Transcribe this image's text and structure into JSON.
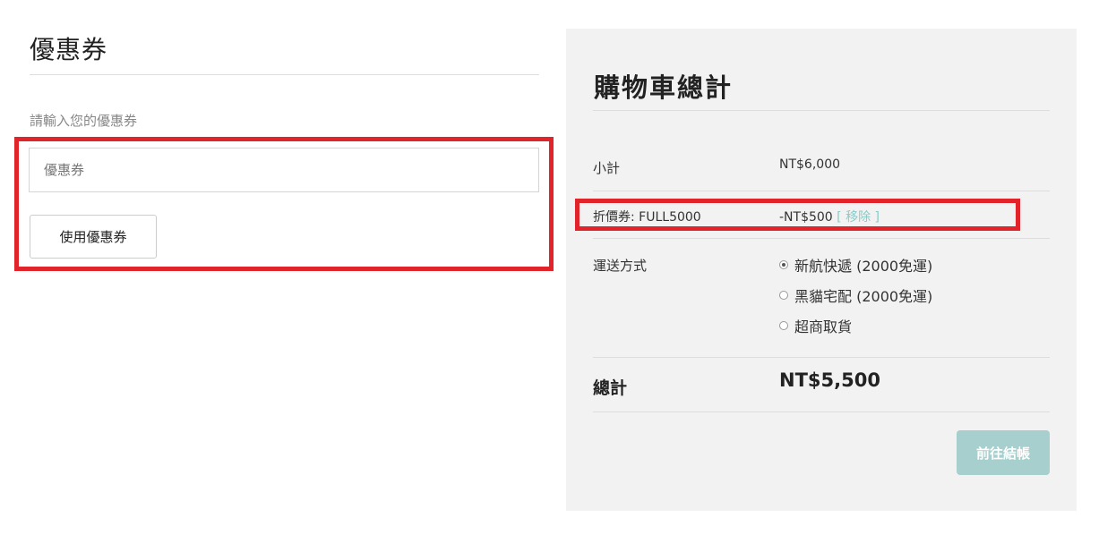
{
  "coupon": {
    "title": "優惠券",
    "label": "請輸入您的優惠券",
    "input_placeholder": "優惠券",
    "input_value": "",
    "apply_button": "使用優惠券"
  },
  "cart": {
    "title": "購物車總計",
    "subtotal_label": "小計",
    "subtotal_value": "NT$6,000",
    "discount_label": "折價券: FULL5000",
    "discount_value": "-NT$500",
    "remove_link": "[ 移除 ]",
    "shipping_label": "運送方式",
    "shipping_options": [
      {
        "label": "新航快遞 (2000免運)",
        "selected": true
      },
      {
        "label": "黑貓宅配 (2000免運)",
        "selected": false
      },
      {
        "label": "超商取貨",
        "selected": false
      }
    ],
    "total_label": "總計",
    "total_value": "NT$5,500",
    "checkout_button": "前往結帳"
  },
  "colors": {
    "highlight": "#e1232a",
    "panel_bg": "#f2f2f2",
    "accent": "#a6cfcd",
    "link": "#8ccac7"
  }
}
